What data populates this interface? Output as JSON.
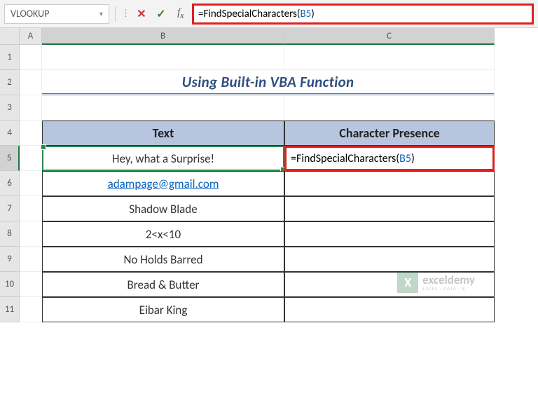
{
  "namebox": "VLOOKUP",
  "formula": {
    "prefix": "=",
    "fn": "FindSpecialCharacters(",
    "ref": "B5",
    "suffix": ")"
  },
  "columns": [
    "A",
    "B",
    "C"
  ],
  "rows": [
    "1",
    "2",
    "3",
    "4",
    "5",
    "6",
    "7",
    "8",
    "9",
    "10",
    "11"
  ],
  "title": "Using Built-in VBA Function",
  "headers": {
    "text": "Text",
    "presence": "Character Presence"
  },
  "data": {
    "b5": "Hey, what a Surprise!",
    "b6": "adampage@gmail.com",
    "b7": "Shadow Blade",
    "b8": "2<x<10",
    "b9": "No Holds Barred",
    "b10": "Bread & Butter",
    "b11": "Eibar King"
  },
  "watermark": {
    "brand": "exceldemy",
    "tag": "EXCEL · DATA · B"
  }
}
